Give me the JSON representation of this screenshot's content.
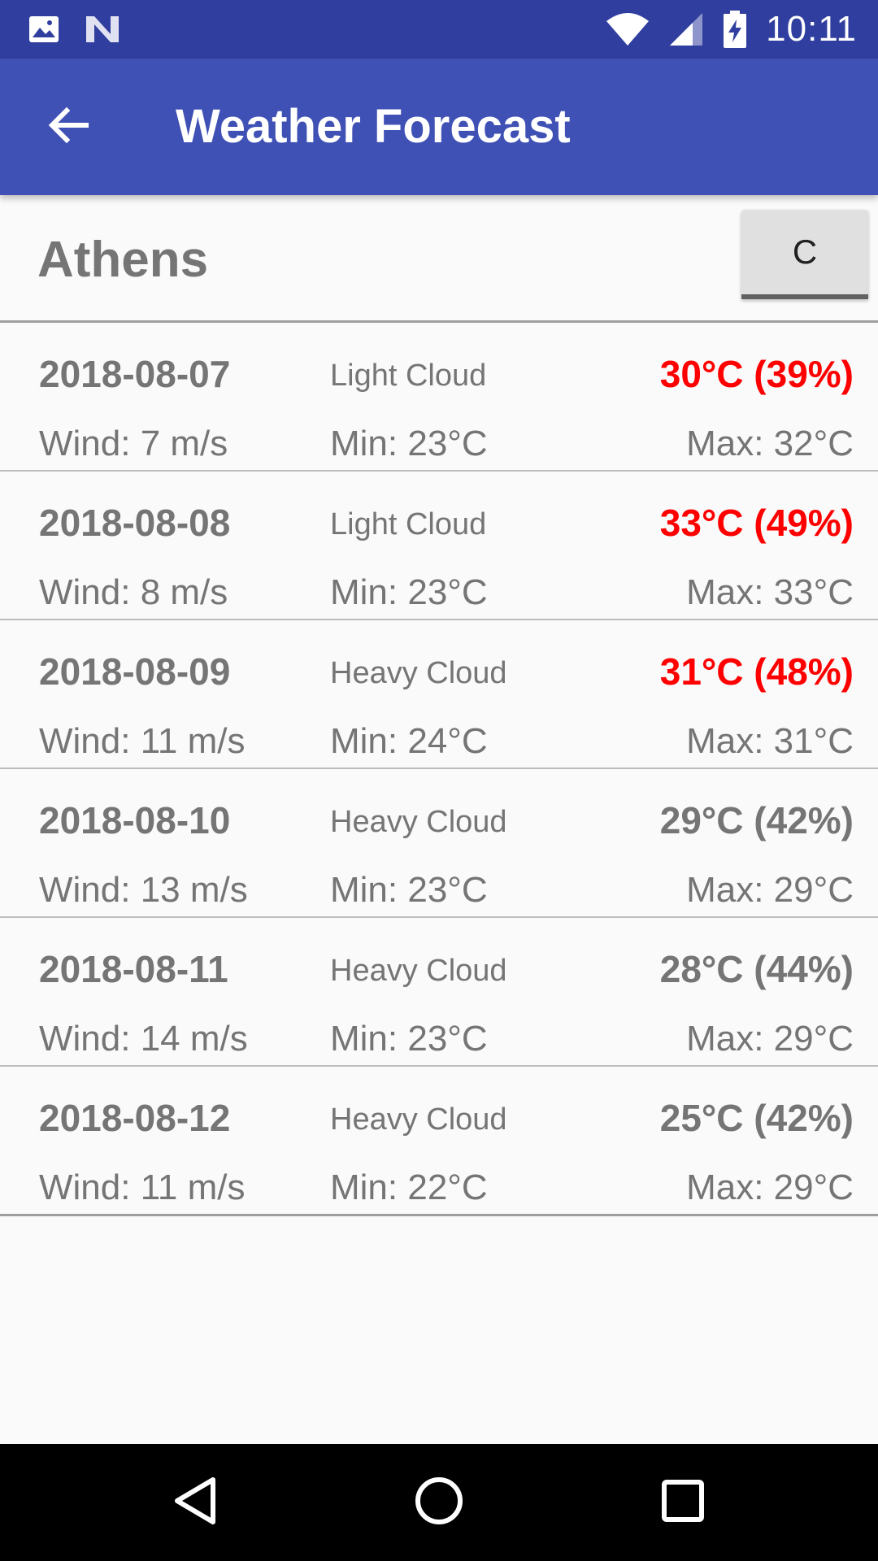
{
  "status_bar": {
    "time": "10:11",
    "icons": [
      "image-icon",
      "n-icon",
      "wifi-icon",
      "cell-signal-icon",
      "battery-charging-icon"
    ]
  },
  "app_bar": {
    "title": "Weather Forecast",
    "back_icon": "arrow-back-icon"
  },
  "city": {
    "name": "Athens",
    "unit_button_label": "C"
  },
  "forecast": [
    {
      "date": "2018-08-07",
      "description": "Light Cloud",
      "temp": "30°C (39%)",
      "wind": "Wind: 7 m/s",
      "min": "Min: 23°C",
      "max": "Max: 32°C",
      "highlight": true
    },
    {
      "date": "2018-08-08",
      "description": "Light Cloud",
      "temp": "33°C (49%)",
      "wind": "Wind: 8 m/s",
      "min": "Min: 23°C",
      "max": "Max: 33°C",
      "highlight": true
    },
    {
      "date": "2018-08-09",
      "description": "Heavy Cloud",
      "temp": "31°C (48%)",
      "wind": "Wind: 11 m/s",
      "min": "Min: 24°C",
      "max": "Max: 31°C",
      "highlight": true
    },
    {
      "date": "2018-08-10",
      "description": "Heavy Cloud",
      "temp": "29°C (42%)",
      "wind": "Wind: 13 m/s",
      "min": "Min: 23°C",
      "max": "Max: 29°C",
      "highlight": false
    },
    {
      "date": "2018-08-11",
      "description": "Heavy Cloud",
      "temp": "28°C (44%)",
      "wind": "Wind: 14 m/s",
      "min": "Min: 23°C",
      "max": "Max: 29°C",
      "highlight": false
    },
    {
      "date": "2018-08-12",
      "description": "Heavy Cloud",
      "temp": "25°C (42%)",
      "wind": "Wind: 11 m/s",
      "min": "Min: 22°C",
      "max": "Max: 29°C",
      "highlight": false
    }
  ],
  "nav_bar": {
    "icons": [
      "nav-back-icon",
      "nav-home-icon",
      "nav-recents-icon"
    ]
  },
  "colors": {
    "status_bar": "#303f9f",
    "app_bar": "#3f51b5",
    "highlight_temp": "#ff0000",
    "secondary_text": "#757575"
  }
}
